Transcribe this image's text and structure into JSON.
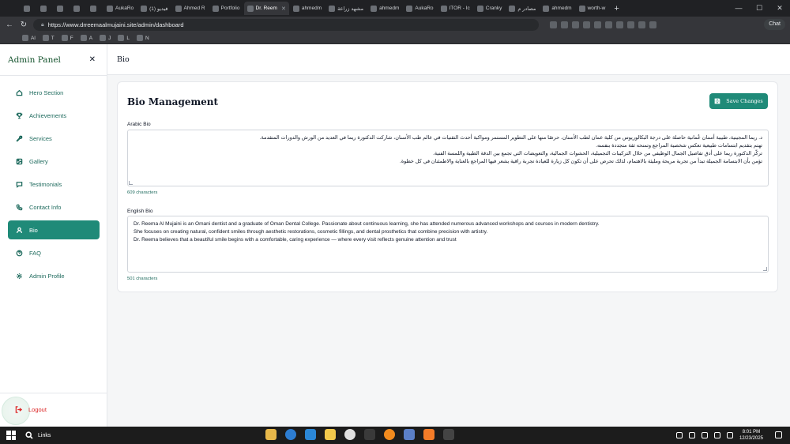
{
  "browser": {
    "tabs": [
      {
        "label": "",
        "active": false
      },
      {
        "label": "",
        "active": false
      },
      {
        "label": "",
        "active": false
      },
      {
        "label": "",
        "active": false
      },
      {
        "label": "",
        "active": false
      },
      {
        "label": "AukaRo",
        "active": false
      },
      {
        "label": "(1) فيديو",
        "active": false
      },
      {
        "label": "Ahmed R",
        "active": false
      },
      {
        "label": "Portfolio",
        "active": false
      },
      {
        "label": "Dr. Reem",
        "active": true
      },
      {
        "label": "ahmedm",
        "active": false
      },
      {
        "label": "مشهد زراعة",
        "active": false
      },
      {
        "label": "ahmedm",
        "active": false
      },
      {
        "label": "AukaRo",
        "active": false
      },
      {
        "label": "ITOR - Ic",
        "active": false
      },
      {
        "label": "Cranky",
        "active": false
      },
      {
        "label": "مصادر م",
        "active": false
      },
      {
        "label": "ahmedm",
        "active": false
      },
      {
        "label": "worth-w",
        "active": false
      }
    ],
    "url": "https://www.drreemaalmujaini.site/admin/dashboard",
    "copilot_label": "Chat",
    "bookmarks": [
      "Al",
      "T",
      "F",
      "A",
      "J",
      "L",
      "N"
    ]
  },
  "sidebar": {
    "title": "Admin Panel",
    "items": [
      {
        "label": "Hero Section",
        "icon": "home-icon",
        "active": false
      },
      {
        "label": "Achievements",
        "icon": "trophy-icon",
        "active": false
      },
      {
        "label": "Services",
        "icon": "wrench-icon",
        "active": false
      },
      {
        "label": "Gallery",
        "icon": "image-icon",
        "active": false
      },
      {
        "label": "Testimonials",
        "icon": "message-icon",
        "active": false
      },
      {
        "label": "Contact Info",
        "icon": "phone-icon",
        "active": false
      },
      {
        "label": "Bio",
        "icon": "user-icon",
        "active": true
      },
      {
        "label": "FAQ",
        "icon": "help-circle-icon",
        "active": false
      },
      {
        "label": "Admin Profile",
        "icon": "gear-icon",
        "active": false
      }
    ],
    "logout_label": "Logout"
  },
  "header": {
    "title": "Bio"
  },
  "bio": {
    "title": "Bio Management",
    "save_label": "Save Changes",
    "arabic": {
      "label": "Arabic Bio",
      "lines": [
        "د. ريما المجينية، طبيبة أسنان عُمانية حاصلة على درجة البكالوريوس من كلية عمان لطب الأسنان. حرصًا منها على التطوير المستمر ومواكبة أحدث التقنيات في عالم طب الأسنان، شاركت الدكتورة ريما في العديد من الورش والدورات المتقدمة.",
        "تهتم بتقديم ابتسامات طبيعية تعكس شخصية المراجع وتمنحه ثقة متجددة بنفسه.",
        "تركّز الدكتورة ريما على أدق تفاصيل الجمال الوظيفي من خلال التركيبات التجميلية، الحشوات الجمالية، والتعويضات التي تجمع بين الدقة الطبية واللمسة الفنية.",
        "تؤمن بأن الابتسامة الجميلة تبدأ من تجربة مريحة ومليئة بالاهتمام، لذلك تحرص على أن تكون كل زيارة للعيادة تجربة راقية يشعر فيها المراجع بالعناية والاطمئنان في كل خطوة."
      ],
      "char_count": "609 characters"
    },
    "english": {
      "label": "English Bio",
      "lines": [
        "Dr. Reema Al Mujaini is an Omani dentist and a graduate of Oman Dental College. Passionate about continuous learning, she has attended numerous advanced workshops and courses in modern dentistry.",
        "She focuses on creating natural, confident smiles through aesthetic restorations, cosmetic fillings, and dental prosthetics that combine precision with artistry.",
        "Dr. Reema believes that a beautiful smile begins with a comfortable, caring experience — where every visit reflects genuine attention and trust"
      ],
      "char_count": "501 characters"
    }
  },
  "taskbar": {
    "search_label": "Links",
    "time": "8:01 PM",
    "date": "12/23/2025"
  },
  "colors": {
    "accent": "#1f8a78",
    "brand_text": "#14532d",
    "logout": "#dc2626"
  }
}
